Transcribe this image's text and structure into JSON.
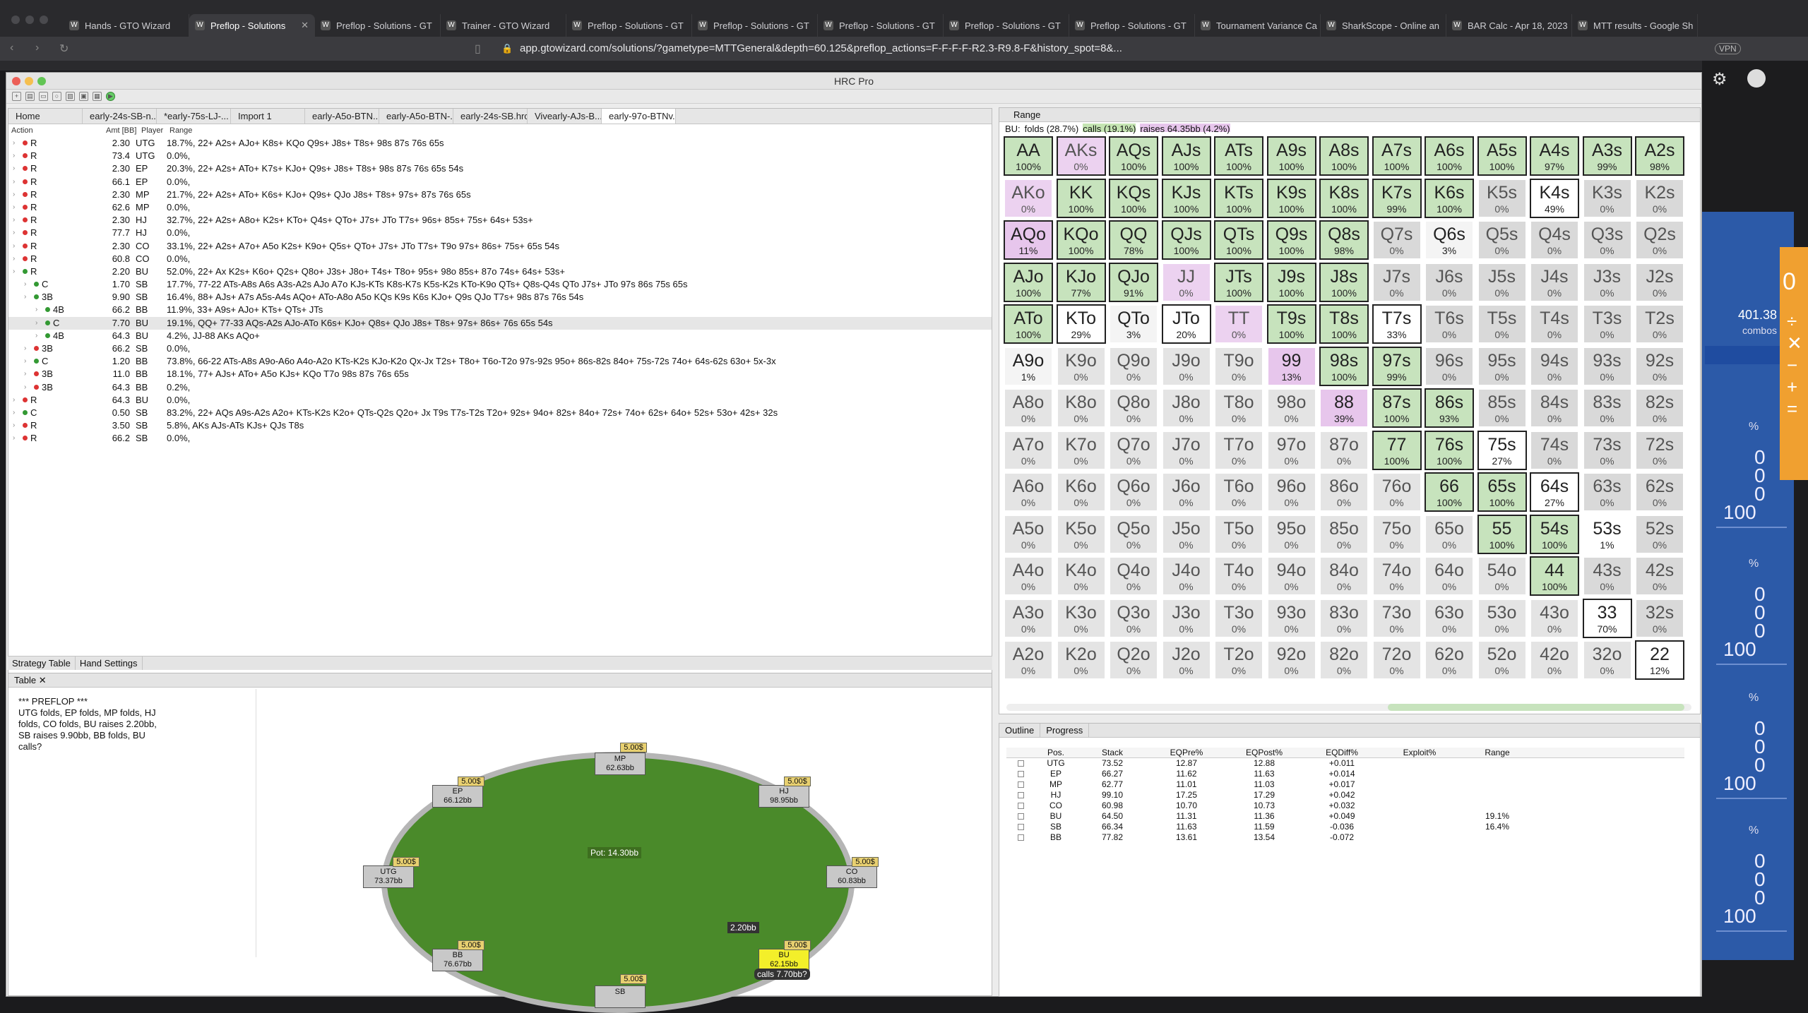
{
  "browser": {
    "tabs": [
      "Hands - GTO Wizard",
      "Preflop - Solutions",
      "Preflop - Solutions - GT",
      "Trainer - GTO Wizard",
      "Preflop - Solutions - GT",
      "Preflop - Solutions - GT",
      "Preflop - Solutions - GT",
      "Preflop - Solutions - GT",
      "Preflop - Solutions - GT",
      "Tournament Variance Ca",
      "SharkScope - Online an",
      "BAR Calc - Apr 18, 2023",
      "MTT results - Google Sh"
    ],
    "url": "app.gtowizard.com/solutions/?gametype=MTTGeneral&depth=60.125&preflop_actions=F-F-F-F-R2.3-R9.8-F&history_spot=8&...",
    "vpn": "VPN"
  },
  "hrc": {
    "title": "HRC Pro",
    "editor_tabs": [
      "Home",
      "early-24s-SB-n...",
      "*early-75s-LJ-...",
      "Import 1",
      "early-A5o-BTN....",
      "early-A5o-BTN-...",
      "early-24s-SB.hrcv",
      "Vivearly-AJs-B...",
      "early-97o-BTNv..."
    ],
    "columns": [
      "Action",
      "Amt [BB]",
      "Player",
      "Range"
    ],
    "rows": [
      [
        "R",
        "2.30",
        "UTG",
        "18.7%, 22+ A2s+ AJo+ K8s+ KQo Q9s+ J8s+ T8s+ 98s 87s 76s 65s"
      ],
      [
        "R",
        "73.4",
        "UTG",
        "0.0%,"
      ],
      [
        "R",
        "2.30",
        "EP",
        "20.3%, 22+ A2s+ ATo+ K7s+ KJo+ Q9s+ J8s+ T8s+ 98s 87s 76s 65s 54s"
      ],
      [
        "R",
        "66.1",
        "EP",
        "0.0%,"
      ],
      [
        "R",
        "2.30",
        "MP",
        "21.7%, 22+ A2s+ ATo+ K6s+ KJo+ Q9s+ QJo J8s+ T8s+ 97s+ 87s 76s 65s"
      ],
      [
        "R",
        "62.6",
        "MP",
        "0.0%,"
      ],
      [
        "R",
        "2.30",
        "HJ",
        "32.7%, 22+ A2s+ A8o+ K2s+ KTo+ Q4s+ QTo+ J7s+ JTo T7s+ 96s+ 85s+ 75s+ 64s+ 53s+"
      ],
      [
        "R",
        "77.7",
        "HJ",
        "0.0%,"
      ],
      [
        "R",
        "2.30",
        "CO",
        "33.1%, 22+ A2s+ A7o+ A5o K2s+ K9o+ Q5s+ QTo+ J7s+ JTo T7s+ T9o 97s+ 86s+ 75s+ 65s 54s"
      ],
      [
        "R",
        "60.8",
        "CO",
        "0.0%,"
      ],
      [
        "R",
        "2.20",
        "BU",
        "52.0%, 22+ Ax K2s+ K6o+ Q2s+ Q8o+ J3s+ J8o+ T4s+ T8o+ 95s+ 98o 85s+ 87o 74s+ 64s+ 53s+"
      ],
      [
        "C",
        "1.70",
        "SB",
        "17.7%, 77-22 ATs-A8s A6s A3s-A2s AJo A7o KJs-KTs K8s-K7s K5s-K2s KTo-K9o QTs+ Q8s-Q4s QTo J7s+ JTo 97s 86s 75s 65s"
      ],
      [
        "3B",
        "9.90",
        "SB",
        "16.4%, 88+ AJs+ A7s A5s-A4s AQo+ ATo-A8o A5o KQs K9s K6s KJo+ Q9s QJo T7s+ 98s 87s 76s 54s"
      ],
      [
        "4B",
        "66.2",
        "BB",
        "11.9%, 33+ A9s+ AJo+ KTs+ QTs+ JTs"
      ],
      [
        "C",
        "7.70",
        "BU",
        "19.1%, QQ+ 77-33 AQs-A2s AJo-ATo K6s+ KJo+ Q8s+ QJo J8s+ T8s+ 97s+ 86s+ 76s 65s 54s"
      ],
      [
        "4B",
        "64.3",
        "BU",
        "4.2%, JJ-88 AKs AQo+"
      ],
      [
        "3B",
        "66.2",
        "SB",
        "0.0%,"
      ],
      [
        "C",
        "1.20",
        "BB",
        "73.8%, 66-22 ATs-A8s A9o-A6o A4o-A2o KTs-K2s KJo-K2o Qx-Jx T2s+ T8o+ T6o-T2o 97s-92s 95o+ 86s-82s 84o+ 75s-72s 74o+ 64s-62s 63o+ 5x-3x"
      ],
      [
        "3B",
        "11.0",
        "BB",
        "18.1%, 77+ AJs+ ATo+ A5o KJs+ KQo T7o 98s 87s 76s 65s"
      ],
      [
        "3B",
        "64.3",
        "BB",
        "0.2%,"
      ],
      [
        "R",
        "64.3",
        "BU",
        "0.0%,"
      ],
      [
        "C",
        "0.50",
        "SB",
        "83.2%, 22+ AQs A9s-A2s A2o+ KTs-K2s K2o+ QTs-Q2s Q2o+ Jx T9s T7s-T2s T2o+ 92s+ 94o+ 82s+ 84o+ 72s+ 74o+ 62s+ 64o+ 52s+ 53o+ 42s+ 32s"
      ],
      [
        "R",
        "3.50",
        "SB",
        "5.8%, AKs AJs-ATs KJs+ QJs T8s"
      ],
      [
        "R",
        "66.2",
        "SB",
        "0.0%,"
      ]
    ],
    "bottom_tabs": [
      "Strategy Table",
      "Hand Settings"
    ],
    "table_tab": "Table",
    "history": "*** PREFLOP ***\nUTG folds, EP folds, MP folds, HJ folds, CO folds, BU raises 2.20bb, SB raises 9.90bb, BB folds, BU calls?",
    "seats": [
      {
        "name": "MP",
        "stack": "62.63bb",
        "stake": "5.00$"
      },
      {
        "name": "EP",
        "stack": "66.12bb",
        "stake": "5.00$"
      },
      {
        "name": "HJ",
        "stack": "98.95bb",
        "stake": "5.00$"
      },
      {
        "name": "UTG",
        "stack": "73.37bb",
        "stake": "5.00$"
      },
      {
        "name": "CO",
        "stack": "60.83bb",
        "stake": "5.00$"
      },
      {
        "name": "BB",
        "stack": "76.67bb",
        "stake": "5.00$"
      },
      {
        "name": "BU",
        "stack": "62.15bb",
        "stake": "5.00$"
      },
      {
        "name": "SB",
        "stack": "",
        "stake": "5.00$"
      }
    ],
    "pot": "Pot:   14.30bb",
    "bu_bet": "2.20bb",
    "bu_action": "calls 7.70bb?",
    "range_tab": "Range",
    "range_info": {
      "prefix": "BU:",
      "folds": "folds (28.7%)",
      "calls": "calls (19.1%)",
      "raises": "raises 64.35bb (4.2%)"
    },
    "grid": [
      [
        [
          "AA",
          "100%"
        ],
        [
          "AKs",
          "0%"
        ],
        [
          "AQs",
          "100%"
        ],
        [
          "AJs",
          "100%"
        ],
        [
          "ATs",
          "100%"
        ],
        [
          "A9s",
          "100%"
        ],
        [
          "A8s",
          "100%"
        ],
        [
          "A7s",
          "100%"
        ],
        [
          "A6s",
          "100%"
        ],
        [
          "A5s",
          "100%"
        ],
        [
          "A4s",
          "97%"
        ],
        [
          "A3s",
          "99%"
        ],
        [
          "A2s",
          "98%"
        ]
      ],
      [
        [
          "AKo",
          "0%"
        ],
        [
          "KK",
          "100%"
        ],
        [
          "KQs",
          "100%"
        ],
        [
          "KJs",
          "100%"
        ],
        [
          "KTs",
          "100%"
        ],
        [
          "K9s",
          "100%"
        ],
        [
          "K8s",
          "100%"
        ],
        [
          "K7s",
          "99%"
        ],
        [
          "K6s",
          "100%"
        ],
        [
          "K5s",
          "0%"
        ],
        [
          "K4s",
          "49%"
        ],
        [
          "K3s",
          "0%"
        ],
        [
          "K2s",
          "0%"
        ]
      ],
      [
        [
          "AQo",
          "11%"
        ],
        [
          "KQo",
          "100%"
        ],
        [
          "QQ",
          "78%"
        ],
        [
          "QJs",
          "100%"
        ],
        [
          "QTs",
          "100%"
        ],
        [
          "Q9s",
          "100%"
        ],
        [
          "Q8s",
          "98%"
        ],
        [
          "Q7s",
          "0%"
        ],
        [
          "Q6s",
          "3%"
        ],
        [
          "Q5s",
          "0%"
        ],
        [
          "Q4s",
          "0%"
        ],
        [
          "Q3s",
          "0%"
        ],
        [
          "Q2s",
          "0%"
        ]
      ],
      [
        [
          "AJo",
          "100%"
        ],
        [
          "KJo",
          "77%"
        ],
        [
          "QJo",
          "91%"
        ],
        [
          "JJ",
          "0%"
        ],
        [
          "JTs",
          "100%"
        ],
        [
          "J9s",
          "100%"
        ],
        [
          "J8s",
          "100%"
        ],
        [
          "J7s",
          "0%"
        ],
        [
          "J6s",
          "0%"
        ],
        [
          "J5s",
          "0%"
        ],
        [
          "J4s",
          "0%"
        ],
        [
          "J3s",
          "0%"
        ],
        [
          "J2s",
          "0%"
        ]
      ],
      [
        [
          "ATo",
          "100%"
        ],
        [
          "KTo",
          "29%"
        ],
        [
          "QTo",
          "3%"
        ],
        [
          "JTo",
          "20%"
        ],
        [
          "TT",
          "0%"
        ],
        [
          "T9s",
          "100%"
        ],
        [
          "T8s",
          "100%"
        ],
        [
          "T7s",
          "33%"
        ],
        [
          "T6s",
          "0%"
        ],
        [
          "T5s",
          "0%"
        ],
        [
          "T4s",
          "0%"
        ],
        [
          "T3s",
          "0%"
        ],
        [
          "T2s",
          "0%"
        ]
      ],
      [
        [
          "A9o",
          "1%"
        ],
        [
          "K9o",
          "0%"
        ],
        [
          "Q9o",
          "0%"
        ],
        [
          "J9o",
          "0%"
        ],
        [
          "T9o",
          "0%"
        ],
        [
          "99",
          "13%"
        ],
        [
          "98s",
          "100%"
        ],
        [
          "97s",
          "99%"
        ],
        [
          "96s",
          "0%"
        ],
        [
          "95s",
          "0%"
        ],
        [
          "94s",
          "0%"
        ],
        [
          "93s",
          "0%"
        ],
        [
          "92s",
          "0%"
        ]
      ],
      [
        [
          "A8o",
          "0%"
        ],
        [
          "K8o",
          "0%"
        ],
        [
          "Q8o",
          "0%"
        ],
        [
          "J8o",
          "0%"
        ],
        [
          "T8o",
          "0%"
        ],
        [
          "98o",
          "0%"
        ],
        [
          "88",
          "39%"
        ],
        [
          "87s",
          "100%"
        ],
        [
          "86s",
          "93%"
        ],
        [
          "85s",
          "0%"
        ],
        [
          "84s",
          "0%"
        ],
        [
          "83s",
          "0%"
        ],
        [
          "82s",
          "0%"
        ]
      ],
      [
        [
          "A7o",
          "0%"
        ],
        [
          "K7o",
          "0%"
        ],
        [
          "Q7o",
          "0%"
        ],
        [
          "J7o",
          "0%"
        ],
        [
          "T7o",
          "0%"
        ],
        [
          "97o",
          "0%"
        ],
        [
          "87o",
          "0%"
        ],
        [
          "77",
          "100%"
        ],
        [
          "76s",
          "100%"
        ],
        [
          "75s",
          "27%"
        ],
        [
          "74s",
          "0%"
        ],
        [
          "73s",
          "0%"
        ],
        [
          "72s",
          "0%"
        ]
      ],
      [
        [
          "A6o",
          "0%"
        ],
        [
          "K6o",
          "0%"
        ],
        [
          "Q6o",
          "0%"
        ],
        [
          "J6o",
          "0%"
        ],
        [
          "T6o",
          "0%"
        ],
        [
          "96o",
          "0%"
        ],
        [
          "86o",
          "0%"
        ],
        [
          "76o",
          "0%"
        ],
        [
          "66",
          "100%"
        ],
        [
          "65s",
          "100%"
        ],
        [
          "64s",
          "27%"
        ],
        [
          "63s",
          "0%"
        ],
        [
          "62s",
          "0%"
        ]
      ],
      [
        [
          "A5o",
          "0%"
        ],
        [
          "K5o",
          "0%"
        ],
        [
          "Q5o",
          "0%"
        ],
        [
          "J5o",
          "0%"
        ],
        [
          "T5o",
          "0%"
        ],
        [
          "95o",
          "0%"
        ],
        [
          "85o",
          "0%"
        ],
        [
          "75o",
          "0%"
        ],
        [
          "65o",
          "0%"
        ],
        [
          "55",
          "100%"
        ],
        [
          "54s",
          "100%"
        ],
        [
          "53s",
          "1%"
        ],
        [
          "52s",
          "0%"
        ]
      ],
      [
        [
          "A4o",
          "0%"
        ],
        [
          "K4o",
          "0%"
        ],
        [
          "Q4o",
          "0%"
        ],
        [
          "J4o",
          "0%"
        ],
        [
          "T4o",
          "0%"
        ],
        [
          "94o",
          "0%"
        ],
        [
          "84o",
          "0%"
        ],
        [
          "74o",
          "0%"
        ],
        [
          "64o",
          "0%"
        ],
        [
          "54o",
          "0%"
        ],
        [
          "44",
          "100%"
        ],
        [
          "43s",
          "0%"
        ],
        [
          "42s",
          "0%"
        ]
      ],
      [
        [
          "A3o",
          "0%"
        ],
        [
          "K3o",
          "0%"
        ],
        [
          "Q3o",
          "0%"
        ],
        [
          "J3o",
          "0%"
        ],
        [
          "T3o",
          "0%"
        ],
        [
          "93o",
          "0%"
        ],
        [
          "83o",
          "0%"
        ],
        [
          "73o",
          "0%"
        ],
        [
          "63o",
          "0%"
        ],
        [
          "53o",
          "0%"
        ],
        [
          "43o",
          "0%"
        ],
        [
          "33",
          "70%"
        ],
        [
          "32s",
          "0%"
        ]
      ],
      [
        [
          "A2o",
          "0%"
        ],
        [
          "K2o",
          "0%"
        ],
        [
          "Q2o",
          "0%"
        ],
        [
          "J2o",
          "0%"
        ],
        [
          "T2o",
          "0%"
        ],
        [
          "92o",
          "0%"
        ],
        [
          "82o",
          "0%"
        ],
        [
          "72o",
          "0%"
        ],
        [
          "62o",
          "0%"
        ],
        [
          "52o",
          "0%"
        ],
        [
          "42o",
          "0%"
        ],
        [
          "32o",
          "0%"
        ],
        [
          "22",
          "12%"
        ]
      ]
    ],
    "outline_tabs": [
      "Outline",
      "Progress"
    ],
    "outline_cols": [
      "Pos.",
      "Stack",
      "EQPre%",
      "EQPost%",
      "EQDiff%",
      "Exploit%",
      "Range"
    ],
    "outline_rows": [
      [
        "UTG",
        "73.52",
        "12.87",
        "12.88",
        "+0.011",
        "",
        ""
      ],
      [
        "EP",
        "66.27",
        "11.62",
        "11.63",
        "+0.014",
        "",
        ""
      ],
      [
        "MP",
        "62.77",
        "11.01",
        "11.03",
        "+0.017",
        "",
        ""
      ],
      [
        "HJ",
        "99.10",
        "17.25",
        "17.29",
        "+0.042",
        "",
        ""
      ],
      [
        "CO",
        "60.98",
        "10.70",
        "10.73",
        "+0.032",
        "",
        ""
      ],
      [
        "BU",
        "64.50",
        "11.31",
        "11.36",
        "+0.049",
        "",
        "19.1%"
      ],
      [
        "SB",
        "66.34",
        "11.63",
        "11.59",
        "-0.036",
        "",
        "16.4%"
      ],
      [
        "BB",
        "77.82",
        "13.61",
        "13.54",
        "-0.072",
        "",
        ""
      ]
    ]
  },
  "side": {
    "combos_value": "401.38",
    "combos_label": "combos",
    "pct": "%",
    "zero": "0",
    "hundred": "100"
  }
}
